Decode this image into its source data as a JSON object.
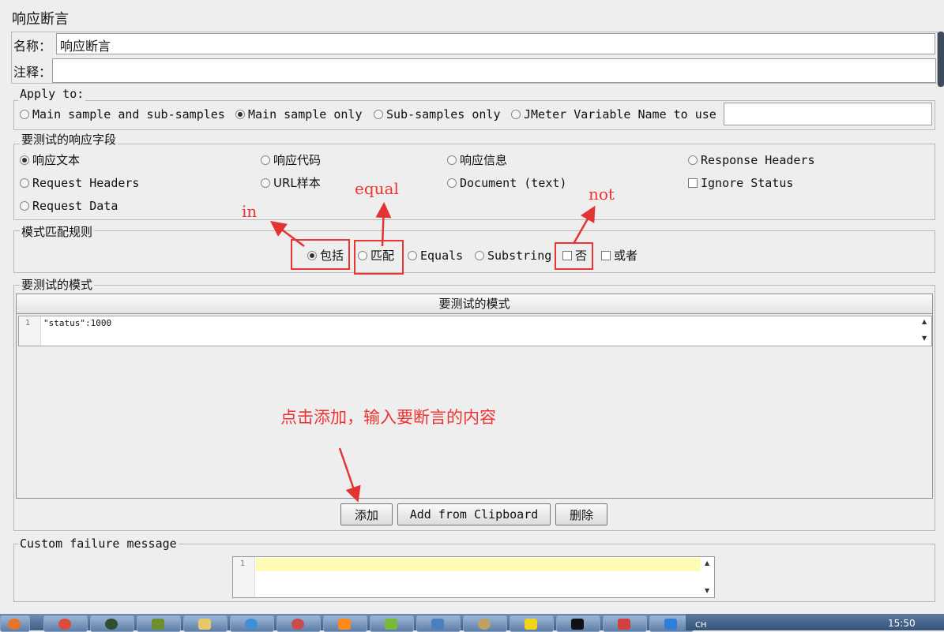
{
  "window": {
    "title": "响应断言"
  },
  "form": {
    "name_label": "名称：",
    "name_value": "响应断言",
    "comment_label": "注释："
  },
  "apply_to": {
    "title": "Apply to:",
    "options": [
      "Main sample and sub-samples",
      "Main sample only",
      "Sub-samples only",
      "JMeter Variable Name to use"
    ],
    "selected": "Main sample only"
  },
  "field_to_test": {
    "title": "要测试的响应字段",
    "options": [
      "响应文本",
      "响应代码",
      "响应信息",
      "Response Headers",
      "Request Headers",
      "URL样本",
      "Document (text)",
      "Ignore Status",
      "Request Data"
    ],
    "selected": "响应文本"
  },
  "pattern_rules": {
    "title": "模式匹配规则",
    "options": [
      "包括",
      "匹配",
      "Equals",
      "Substring",
      "否",
      "或者"
    ],
    "selected": "包括"
  },
  "patterns": {
    "title": "要测试的模式",
    "column_header": "要测试的模式",
    "rows": [
      {
        "line": "1",
        "text": "\"status\":1000"
      }
    ]
  },
  "buttons": {
    "add": "添加",
    "add_clipboard": "Add from Clipboard",
    "delete": "删除"
  },
  "failure": {
    "title": "Custom failure message",
    "line": "1"
  },
  "annotations": {
    "in": "in",
    "equal": "equal",
    "not": "not",
    "hint": "点击添加，输入要断言的内容"
  },
  "taskbar": {
    "clock": "15:50",
    "lang": "CH"
  },
  "colors": {
    "annotation": "#e33333",
    "editor_highlight": "#fefbb4"
  }
}
